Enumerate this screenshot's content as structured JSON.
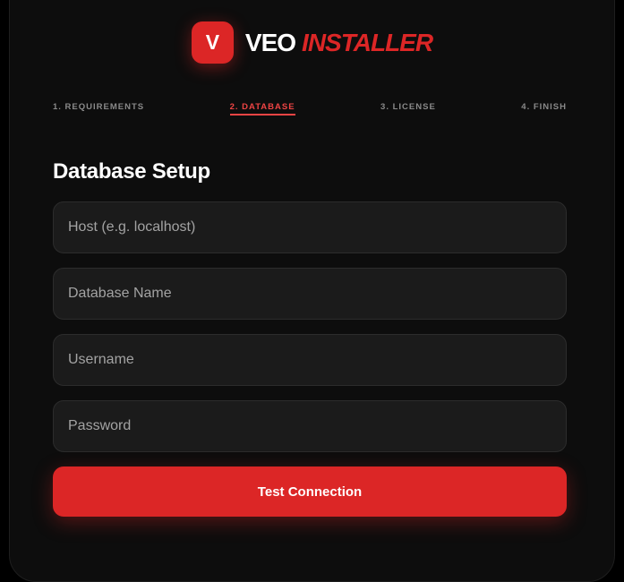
{
  "brand": {
    "logo_letter": "V",
    "name_primary": "VEO",
    "name_accent": "INSTALLER"
  },
  "steps": [
    {
      "label": "1. REQUIREMENTS",
      "active": false
    },
    {
      "label": "2. DATABASE",
      "active": true
    },
    {
      "label": "3. LICENSE",
      "active": false
    },
    {
      "label": "4. FINISH",
      "active": false
    }
  ],
  "form": {
    "title": "Database Setup",
    "host": {
      "placeholder": "Host (e.g. localhost)",
      "value": ""
    },
    "database_name": {
      "placeholder": "Database Name",
      "value": ""
    },
    "username": {
      "placeholder": "Username",
      "value": ""
    },
    "password": {
      "placeholder": "Password",
      "value": ""
    },
    "submit_label": "Test Connection"
  },
  "colors": {
    "accent": "#dc2626",
    "background": "#0d0d0d",
    "input_background": "#1b1b1b"
  }
}
